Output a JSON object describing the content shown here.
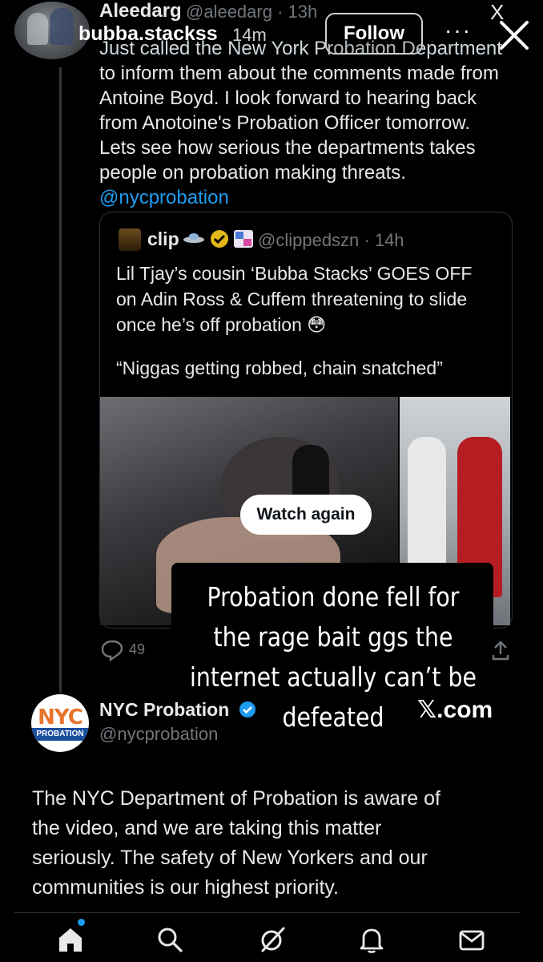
{
  "story": {
    "username": "bubba.stackss",
    "time": "14m",
    "follow_label": "Follow",
    "more_label": "···"
  },
  "tweet1": {
    "name": "Aleedarg",
    "handle": "@aleedarg · 13h",
    "x_logo": "X",
    "body_lines": [
      "Just called the New York Probation Department",
      "to inform them about the comments made from",
      "Antoine Boyd. I look forward to hearing back",
      "from Anotoine's Probation Officer tomorrow.",
      "Lets see how serious the departments takes",
      "people on probation making threats."
    ],
    "mention": "@nycprobation",
    "reply_count": "49"
  },
  "quoted": {
    "name": "clip",
    "handle": "@clippedszn · 14h",
    "body_lines": [
      "Lil Tjay’s cousin ‘Bubba Stacks’ GOES OFF",
      "on Adin Ross & Cuffem threatening to slide",
      "once he’s off probation 😳"
    ],
    "quote_line": "“Niggas getting robbed, chain snatched”",
    "watch_label": "Watch again"
  },
  "caption": {
    "lines": [
      "Probation done fell for",
      "the rage bait ggs the",
      "internet actually can’t be",
      "defeated"
    ],
    "source": "𝕏.com"
  },
  "tweet2": {
    "avatar_text": "NYC",
    "avatar_sub": "PROBATION",
    "name": "NYC Probation",
    "handle": "@nycprobation",
    "body_lines": [
      "The NYC Department of Probation is aware of",
      "the video, and we are taking this matter",
      "seriously. The safety of New Yorkers and our",
      "communities is our highest priority."
    ]
  },
  "nav": {
    "items": [
      "home-icon",
      "search-icon",
      "grok-icon",
      "notifications-icon",
      "messages-icon"
    ]
  },
  "colors": {
    "background": "#000000",
    "text": "#e7e9ea",
    "muted": "#71767b",
    "link": "#1d9bf0",
    "verified_gold": "#e2b719",
    "verified_blue": "#1d9bf0"
  }
}
